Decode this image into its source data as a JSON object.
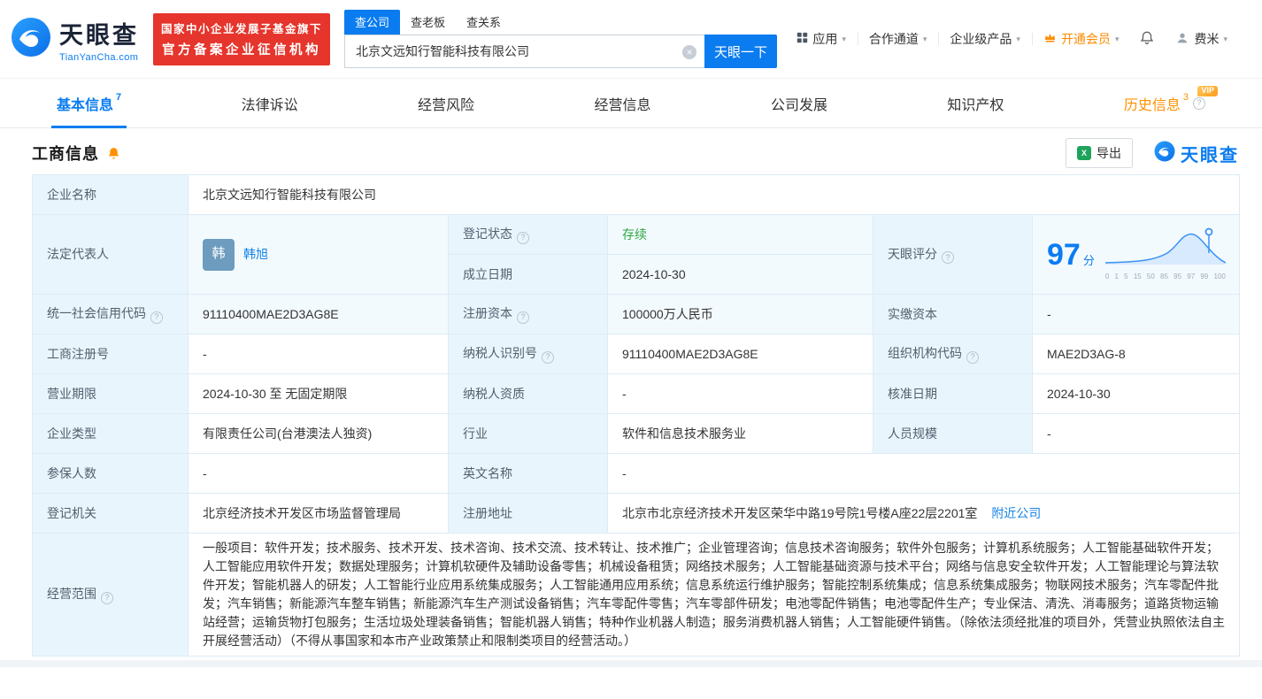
{
  "colors": {
    "primary_blue": "#0a7cf0",
    "badge_red": "#e5352c",
    "member_orange": "#ff8a00",
    "history_orange": "#ff9100",
    "status_green": "#2da641",
    "excel_green": "#1fa35c",
    "label_cell_bg": "#e9f5fd"
  },
  "header": {
    "logo": {
      "name": "天眼查",
      "domain": "TianYanCha.com"
    },
    "badge": {
      "line1": "国家中小企业发展子基金旗下",
      "line2": "官方备案企业征信机构"
    },
    "search_tabs": [
      {
        "label": "查公司"
      },
      {
        "label": "查老板"
      },
      {
        "label": "查关系"
      }
    ],
    "search": {
      "value": "北京文远知行智能科技有限公司",
      "button": "天眼一下"
    },
    "nav": {
      "apps": "应用",
      "partner": "合作通道",
      "enterprise": "企业级产品",
      "member": "开通会员",
      "user": "费米"
    }
  },
  "tabs": {
    "basic": {
      "label": "基本信息",
      "count": "7"
    },
    "legal": {
      "label": "法律诉讼"
    },
    "risk": {
      "label": "经营风险"
    },
    "operation": {
      "label": "经营信息"
    },
    "development": {
      "label": "公司发展"
    },
    "ip": {
      "label": "知识产权"
    },
    "history": {
      "label": "历史信息",
      "count": "3",
      "vip_tag": "VIP"
    }
  },
  "section": {
    "title": "工商信息",
    "export_label": "导出",
    "brand": "天眼查"
  },
  "info": {
    "company_name": {
      "label": "企业名称",
      "value": "北京文远知行智能科技有限公司"
    },
    "legal_rep": {
      "label": "法定代表人",
      "avatar": "韩",
      "name": "韩旭"
    },
    "reg_status": {
      "label": "登记状态",
      "value": "存续"
    },
    "est_date": {
      "label": "成立日期",
      "value": "2024-10-30"
    },
    "score": {
      "label": "天眼评分",
      "value": "97",
      "unit": "分",
      "ticks": [
        "0",
        "1",
        "5",
        "15",
        "50",
        "85",
        "95",
        "97",
        "99",
        "100"
      ]
    },
    "credit_code": {
      "label": "统一社会信用代码",
      "value": "91110400MAE2D3AG8E"
    },
    "reg_capital": {
      "label": "注册资本",
      "value": "100000万人民币"
    },
    "paid_capital": {
      "label": "实缴资本",
      "value": "-"
    },
    "reg_number": {
      "label": "工商注册号",
      "value": "-"
    },
    "taxpayer_id": {
      "label": "纳税人识别号",
      "value": "91110400MAE2D3AG8E"
    },
    "org_code": {
      "label": "组织机构代码",
      "value": "MAE2D3AG-8"
    },
    "business_term": {
      "label": "营业期限",
      "value": "2024-10-30 至 无固定期限"
    },
    "taxpayer_quality": {
      "label": "纳税人资质",
      "value": "-"
    },
    "approval_date": {
      "label": "核准日期",
      "value": "2024-10-30"
    },
    "company_type": {
      "label": "企业类型",
      "value": "有限责任公司(台港澳法人独资)"
    },
    "industry": {
      "label": "行业",
      "value": "软件和信息技术服务业"
    },
    "staff_size": {
      "label": "人员规模",
      "value": "-"
    },
    "insured_count": {
      "label": "参保人数",
      "value": "-"
    },
    "english_name": {
      "label": "英文名称",
      "value": "-"
    },
    "reg_authority": {
      "label": "登记机关",
      "value": "北京经济技术开发区市场监督管理局"
    },
    "reg_address": {
      "label": "注册地址",
      "value": "北京市北京经济技术开发区荣华中路19号院1号楼A座22层2201室",
      "link": "附近公司"
    },
    "business_scope": {
      "label": "经营范围",
      "value": "一般项目：软件开发；技术服务、技术开发、技术咨询、技术交流、技术转让、技术推广；企业管理咨询；信息技术咨询服务；软件外包服务；计算机系统服务；人工智能基础软件开发；人工智能应用软件开发；数据处理服务；计算机软硬件及辅助设备零售；机械设备租赁；网络技术服务；人工智能基础资源与技术平台；网络与信息安全软件开发；人工智能理论与算法软件开发；智能机器人的研发；人工智能行业应用系统集成服务；人工智能通用应用系统；信息系统运行维护服务；智能控制系统集成；信息系统集成服务；物联网技术服务；汽车零配件批发；汽车销售；新能源汽车整车销售；新能源汽车生产测试设备销售；汽车零配件零售；汽车零部件研发；电池零配件销售；电池零配件生产；专业保洁、清洗、消毒服务；道路货物运输站经营；运输货物打包服务；生活垃圾处理装备销售；智能机器人销售；特种作业机器人制造；服务消费机器人销售；人工智能硬件销售。（除依法须经批准的项目外，凭营业执照依法自主开展经营活动）（不得从事国家和本市产业政策禁止和限制类项目的经营活动。）"
    }
  }
}
